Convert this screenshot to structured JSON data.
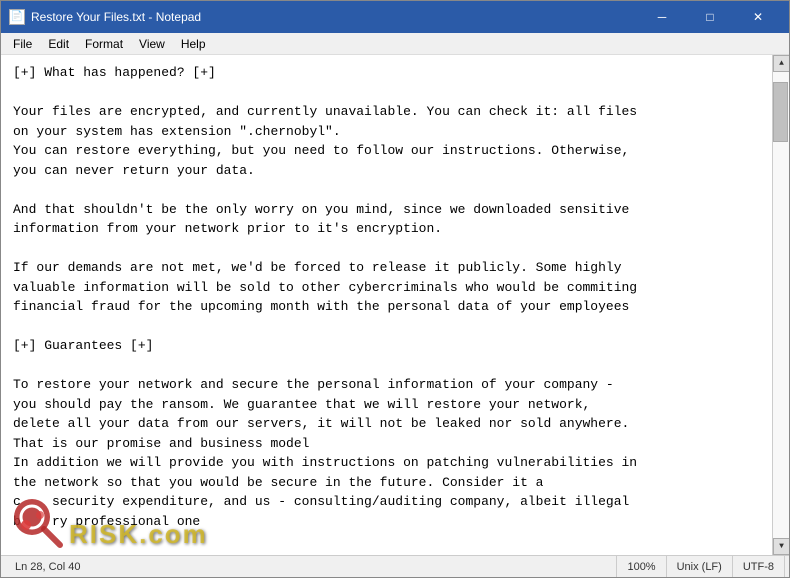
{
  "window": {
    "title": "Restore Your Files.txt - Notepad",
    "icon": "📄"
  },
  "titlebar": {
    "minimize_label": "─",
    "maximize_label": "□",
    "close_label": "✕"
  },
  "menu": {
    "items": [
      "File",
      "Edit",
      "Format",
      "View",
      "Help"
    ]
  },
  "content": {
    "text": "[+] What has happened? [+]\n\nYour files are encrypted, and currently unavailable. You can check it: all files\non your system has extension \".chernobyl\".\nYou can restore everything, but you need to follow our instructions. Otherwise,\nyou can never return your data.\n\nAnd that shouldn't be the only worry on you mind, since we downloaded sensitive\ninformation from your network prior to it's encryption.\n\nIf our demands are not met, we'd be forced to release it publicly. Some highly\nvaluable information will be sold to other cybercriminals who would be commiting\nfinancial fraud for the upcoming month with the personal data of your employees\n\n[+] Guarantees [+]\n\nTo restore your network and secure the personal information of your company -\nyou should pay the ransom. We guarantee that we will restore your network,\ndelete all your data from our servers, it will not be leaked nor sold anywhere.\nThat is our promise and business model\nIn addition we will provide you with instructions on patching vulnerabilities in\nthe network so that you would be secure in the future. Consider it a\nc    security expenditure, and us - consulting/auditing company, albeit illegal\nb    ry professional one"
  },
  "statusbar": {
    "position": "Ln 28, Col 40",
    "zoom": "100%",
    "line_ending": "Unix (LF)",
    "encoding": "UTF-8"
  },
  "watermark": {
    "text": "RISK.com"
  }
}
